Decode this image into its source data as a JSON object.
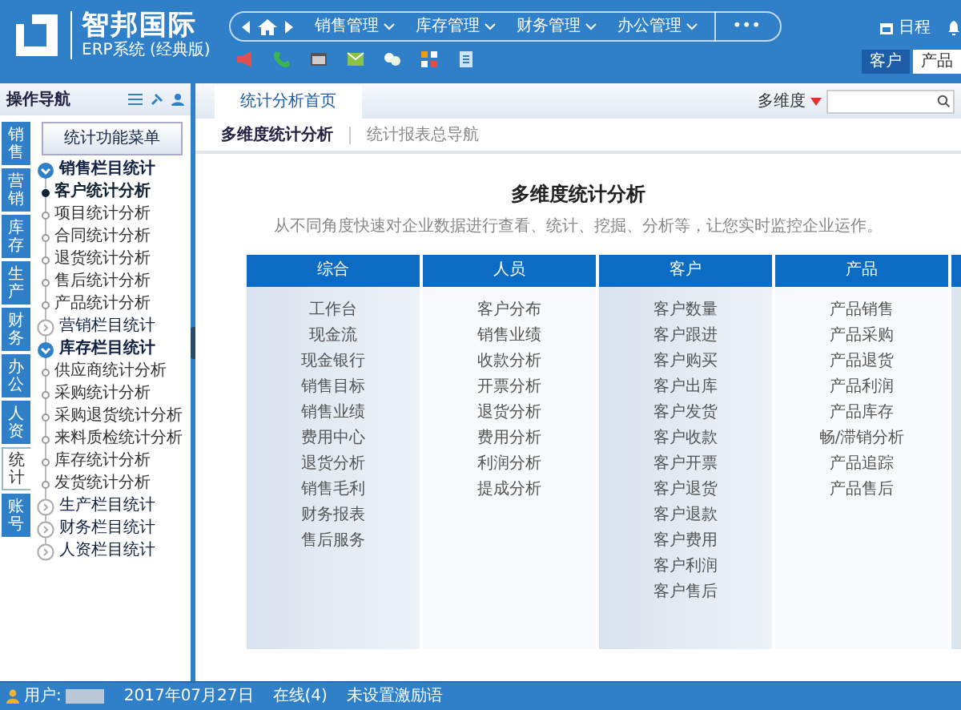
{
  "header": {
    "logo_title": "智邦国际",
    "logo_subtitle": "ERP系统 (经典版)",
    "nav_menus": [
      "销售管理",
      "库存管理",
      "财务管理",
      "办公管理"
    ],
    "more": "•••",
    "schedule": "日程",
    "quick_tabs": [
      {
        "label": "客户",
        "selected": true
      },
      {
        "label": "产品",
        "selected": false
      }
    ]
  },
  "sidebar": {
    "title": "操作导航",
    "vertical_tabs": [
      {
        "label": "销售",
        "selected": false
      },
      {
        "label": "营销",
        "selected": false
      },
      {
        "label": "库存",
        "selected": false
      },
      {
        "label": "生产",
        "selected": false
      },
      {
        "label": "财务",
        "selected": false
      },
      {
        "label": "办公",
        "selected": false
      },
      {
        "label": "人资",
        "selected": false
      },
      {
        "label": "统计",
        "selected": true
      },
      {
        "label": "账号",
        "selected": false
      }
    ],
    "menu_button": "统计功能菜单",
    "tree": [
      {
        "label": "销售栏目统计",
        "expanded": true,
        "children": [
          {
            "label": "客户统计分析",
            "selected": true
          },
          {
            "label": "项目统计分析",
            "selected": false
          },
          {
            "label": "合同统计分析",
            "selected": false
          },
          {
            "label": "退货统计分析",
            "selected": false
          },
          {
            "label": "售后统计分析",
            "selected": false
          },
          {
            "label": "产品统计分析",
            "selected": false
          }
        ]
      },
      {
        "label": "营销栏目统计",
        "expanded": false
      },
      {
        "label": "库存栏目统计",
        "expanded": true,
        "children": [
          {
            "label": "供应商统计分析",
            "selected": false
          },
          {
            "label": "采购统计分析",
            "selected": false
          },
          {
            "label": "采购退货统计分析",
            "selected": false
          },
          {
            "label": "来料质检统计分析",
            "selected": false
          },
          {
            "label": "库存统计分析",
            "selected": false
          },
          {
            "label": "发货统计分析",
            "selected": false
          }
        ]
      },
      {
        "label": "生产栏目统计",
        "expanded": false
      },
      {
        "label": "财务栏目统计",
        "expanded": false
      },
      {
        "label": "人资栏目统计",
        "expanded": false
      }
    ]
  },
  "content": {
    "tabs": [
      {
        "label": "统计分析首页",
        "selected": true
      }
    ],
    "dimension_select": "多维度",
    "subtabs": [
      {
        "label": "多维度统计分析",
        "selected": true
      },
      {
        "label": "统计报表总导航",
        "selected": false
      }
    ],
    "heading": "多维度统计分析",
    "description": "从不同角度快速对企业数据进行查看、统计、挖掘、分析等，让您实时监控企业运作。",
    "columns": [
      {
        "title": "综合",
        "items": [
          "工作台",
          "现金流",
          "现金银行",
          "销售目标",
          "销售业绩",
          "费用中心",
          "退货分析",
          "销售毛利",
          "财务报表",
          "售后服务"
        ]
      },
      {
        "title": "人员",
        "items": [
          "客户分布",
          "销售业绩",
          "收款分析",
          "开票分析",
          "退货分析",
          "费用分析",
          "利润分析",
          "提成分析"
        ]
      },
      {
        "title": "客户",
        "items": [
          "客户数量",
          "客户跟进",
          "客户购买",
          "客户出库",
          "客户发货",
          "客户收款",
          "客户开票",
          "客户退货",
          "客户退款",
          "客户费用",
          "客户利润",
          "客户售后"
        ]
      },
      {
        "title": "产品",
        "items": [
          "产品销售",
          "产品采购",
          "产品退货",
          "产品利润",
          "产品库存",
          "畅/滞销分析",
          "产品追踪",
          "产品售后"
        ]
      }
    ]
  },
  "status_bar": {
    "user_label": "用户:",
    "date": "2017年07月27日",
    "online": "在线(4)",
    "motto": "未设置激励语"
  }
}
